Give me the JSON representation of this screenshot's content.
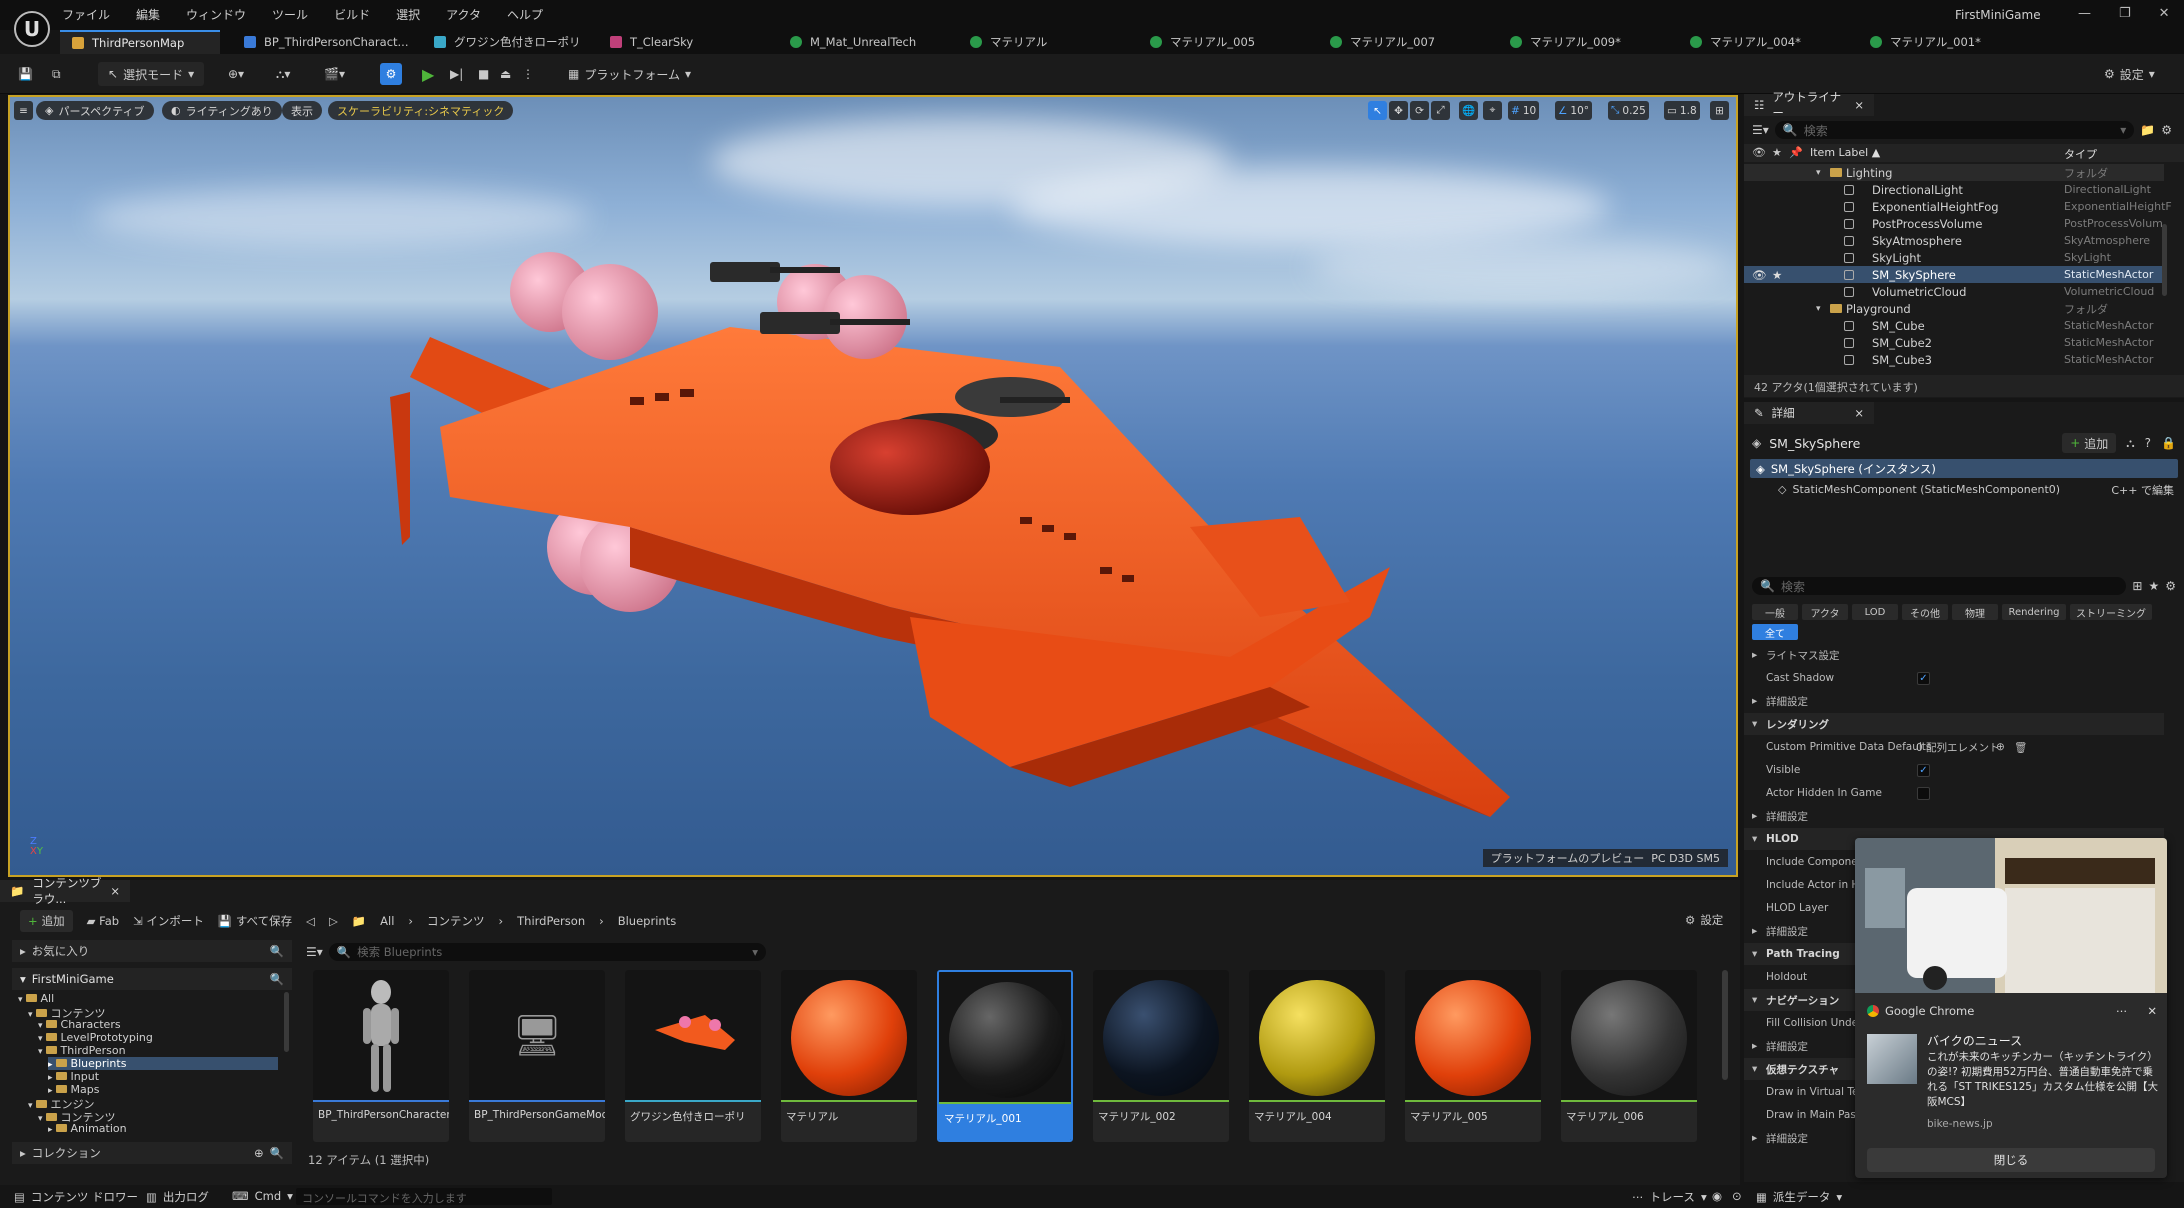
{
  "menu": [
    "ファイル",
    "編集",
    "ウィンドウ",
    "ツール",
    "ビルド",
    "選択",
    "アクタ",
    "ヘルプ"
  ],
  "project_name": "FirstMiniGame",
  "tabs": [
    "ThirdPersonMap",
    "BP_ThirdPersonCharact...",
    "グワジン色付きローポリ",
    "T_ClearSky",
    "M_Mat_UnrealTech",
    "マテリアル",
    "マテリアル_005",
    "マテリアル_007",
    "マテリアル_009*",
    "マテリアル_004*",
    "マテリアル_001*"
  ],
  "toolbar": {
    "select_mode": "選択モード",
    "platform": "プラットフォーム",
    "settings": "設定"
  },
  "viewport": {
    "perspective": "パースペクティブ",
    "lighting": "ライティングあり",
    "show": "表示",
    "scalability": "スケーラビリティ:シネマティック",
    "grid_snap": "10",
    "rot_snap": "10°",
    "scale_snap": "0.25",
    "cam_speed": "1.8",
    "platform_preview": "プラットフォームのプレビュー",
    "platform_value": "PC D3D SM5"
  },
  "outliner": {
    "title": "アウトライナー",
    "search": "検索",
    "col_label": "Item Label ▲",
    "col_type": "タイプ",
    "rows": [
      {
        "label": "Lighting",
        "type": "フォルダ",
        "folder": true,
        "indent": 0
      },
      {
        "label": "DirectionalLight",
        "type": "DirectionalLight",
        "indent": 1
      },
      {
        "label": "ExponentialHeightFog",
        "type": "ExponentialHeightF",
        "indent": 1
      },
      {
        "label": "PostProcessVolume",
        "type": "PostProcessVolum",
        "indent": 1
      },
      {
        "label": "SkyAtmosphere",
        "type": "SkyAtmosphere",
        "indent": 1
      },
      {
        "label": "SkyLight",
        "type": "SkyLight",
        "indent": 1
      },
      {
        "label": "SM_SkySphere",
        "type": "StaticMeshActor",
        "indent": 1,
        "selected": true
      },
      {
        "label": "VolumetricCloud",
        "type": "VolumetricCloud",
        "indent": 1
      },
      {
        "label": "Playground",
        "type": "フォルダ",
        "folder": true,
        "indent": 0
      },
      {
        "label": "SM_Cube",
        "type": "StaticMeshActor",
        "indent": 1
      },
      {
        "label": "SM_Cube2",
        "type": "StaticMeshActor",
        "indent": 1
      },
      {
        "label": "SM_Cube3",
        "type": "StaticMeshActor",
        "indent": 1
      }
    ],
    "footer": "42 アクタ(1個選択されています)"
  },
  "details": {
    "title": "詳細",
    "object": "SM_SkySphere",
    "add": "追加",
    "instance": "SM_SkySphere (インスタンス)",
    "component": "StaticMeshComponent (StaticMeshComponent0)",
    "cpp_edit": "C++ で編集",
    "search": "検索",
    "filters": [
      "一般",
      "アクタ",
      "LOD",
      "その他",
      "物理",
      "Rendering",
      "ストリーミング"
    ],
    "all": "全て",
    "rows": [
      {
        "label": "ライトマス設定",
        "kind": "sub"
      },
      {
        "label": "Cast Shadow",
        "kind": "check",
        "checked": true
      },
      {
        "label": "詳細設定",
        "kind": "sub"
      },
      {
        "label": "レンダリング",
        "kind": "cat"
      },
      {
        "label": "Custom Primitive Data Defaults",
        "kind": "array",
        "value": "0 配列エレメント"
      },
      {
        "label": "Visible",
        "kind": "check",
        "checked": true
      },
      {
        "label": "Actor Hidden In Game",
        "kind": "check",
        "checked": false
      },
      {
        "label": "詳細設定",
        "kind": "sub"
      },
      {
        "label": "HLOD",
        "kind": "cat"
      },
      {
        "label": "Include Component in",
        "kind": "plain"
      },
      {
        "label": "Include Actor in HLOD",
        "kind": "plain"
      },
      {
        "label": "HLOD Layer",
        "kind": "plain"
      },
      {
        "label": "詳細設定",
        "kind": "sub"
      },
      {
        "label": "Path Tracing",
        "kind": "cat"
      },
      {
        "label": "Holdout",
        "kind": "plain"
      },
      {
        "label": "ナビゲーション",
        "kind": "cat"
      },
      {
        "label": "Fill Collision Underneat",
        "kind": "plain"
      },
      {
        "label": "詳細設定",
        "kind": "sub"
      },
      {
        "label": "仮想テクスチャ",
        "kind": "cat"
      },
      {
        "label": "Draw in Virtual Texture",
        "kind": "plain"
      },
      {
        "label": "Draw in Main Pass",
        "kind": "plain"
      },
      {
        "label": "詳細設定",
        "kind": "sub"
      }
    ]
  },
  "content_browser": {
    "title": "コンテンツブラウ...",
    "add": "追加",
    "fab": "Fab",
    "import": "インポート",
    "save_all": "すべて保存",
    "breadcrumb": [
      "All",
      "コンテンツ",
      "ThirdPerson",
      "Blueprints"
    ],
    "settings": "設定",
    "favorites": "お気に入り",
    "project": "FirstMiniGame",
    "search": "検索 Blueprints",
    "tree": [
      {
        "label": "All",
        "d": 0
      },
      {
        "label": "コンテンツ",
        "d": 1
      },
      {
        "label": "Characters",
        "d": 2
      },
      {
        "label": "LevelPrototyping",
        "d": 2
      },
      {
        "label": "ThirdPerson",
        "d": 2
      },
      {
        "label": "Blueprints",
        "d": 3,
        "selected": true
      },
      {
        "label": "Input",
        "d": 3
      },
      {
        "label": "Maps",
        "d": 3
      },
      {
        "label": "エンジン",
        "d": 1
      },
      {
        "label": "コンテンツ",
        "d": 2
      },
      {
        "label": "Animation",
        "d": 3
      }
    ],
    "collections": "コレクション",
    "assets": [
      "BP_ThirdPersonCharacter",
      "BP_ThirdPersonGameMode",
      "グワジン色付きローポリ",
      "マテリアル",
      "マテリアル_001",
      "マテリアル_002",
      "マテリアル_004",
      "マテリアル_005",
      "マテリアル_006"
    ],
    "status": "12 アイテム (1 選択中)"
  },
  "statusbar": {
    "drawer": "コンテンツ ドロワー",
    "output": "出力ログ",
    "cmd": "Cmd",
    "console": "コンソールコマンドを入力します",
    "trace": "トレース",
    "derived": "派生データ"
  },
  "notification": {
    "app": "Google Chrome",
    "title": "バイクのニュース",
    "body": "これが未来のキッチンカー（キッチントライク）の姿!? 初期費用52万円台、普通自動車免許で乗れる「ST TRIKES125」カスタム仕様を公開【大阪MCS】",
    "source": "bike-news.jp",
    "close": "閉じる"
  },
  "colors": {
    "accent": "#2f7fe0",
    "play": "#4fb63a",
    "selection_border": "#c7a224",
    "ship": "#f25a1e"
  }
}
